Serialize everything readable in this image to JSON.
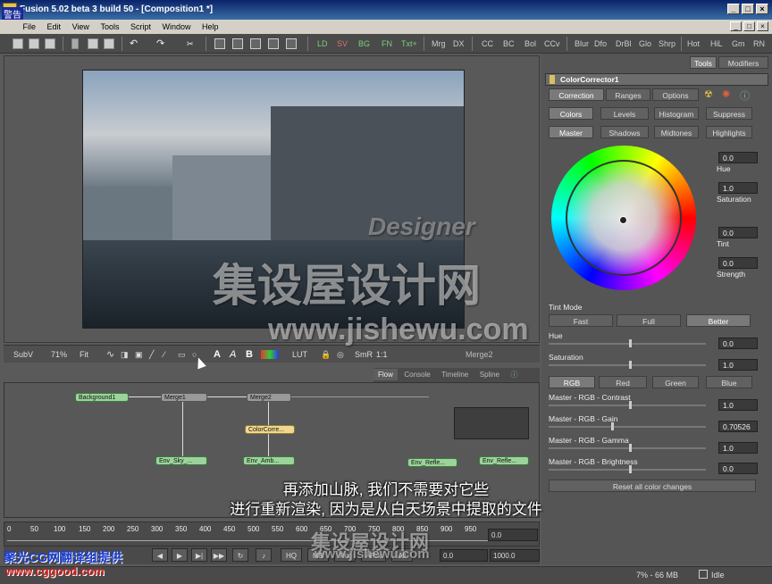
{
  "window": {
    "title": "Fusion 5.02 beta 3 build 50 - [Composition1 *]",
    "buttons": [
      "_",
      "□",
      "×"
    ]
  },
  "menu": [
    "File",
    "Edit",
    "View",
    "Tools",
    "Script",
    "Window",
    "Help"
  ],
  "toolbar": {
    "tools": [
      "LD",
      "SV",
      "BG",
      "FN",
      "Txt+",
      "Mrg",
      "DX",
      "CC",
      "BC",
      "Bol",
      "CCv",
      "Blur",
      "Dfo",
      "DrBl",
      "Glo",
      "Shrp",
      "Hot",
      "HiL",
      "Gm",
      "RN"
    ]
  },
  "viewer": {
    "subview": "SubV",
    "zoom": "71%",
    "fit": "Fit",
    "text_tools": [
      "A",
      "A",
      "B"
    ],
    "lut": "LUT",
    "smr": "SmR",
    "ratio": "1:1",
    "node": "Merge2"
  },
  "flow": {
    "tabs": [
      "Flow",
      "Console",
      "Timeline",
      "Spline"
    ],
    "nodes": {
      "bg": "Background1",
      "m1": "Merge1",
      "m2": "Merge2",
      "cc": "ColorCorre...",
      "sky": "Env_Sky_...",
      "amb": "Env_Amb...",
      "refl1": "Env_Refle...",
      "refl2": "Env_Refle..."
    }
  },
  "timeline": {
    "ticks": [
      "0",
      "50",
      "100",
      "150",
      "200",
      "250",
      "300",
      "350",
      "400",
      "450",
      "500",
      "550",
      "600",
      "650",
      "700",
      "750",
      "800",
      "850",
      "900",
      "950"
    ],
    "current": "0.0"
  },
  "transport": {
    "hq": "HQ",
    "mb": "MB",
    "prx": "Prx",
    "aprx": "APrx",
    "all": "All",
    "render_start": "0.0",
    "render_end": "1000.0"
  },
  "status": {
    "memory": "7% - 66 MB",
    "state": "Idle"
  },
  "panel": {
    "top_tabs": [
      "Tools",
      "Modifiers"
    ],
    "tool_name": "ColorCorrector1",
    "tabs": [
      "Correction",
      "Ranges",
      "Options"
    ],
    "subtabs": [
      "Colors",
      "Levels",
      "Histogram",
      "Suppress"
    ],
    "ranges": [
      "Master",
      "Shadows",
      "Midtones",
      "Highlights"
    ],
    "wheel": {
      "hue_val": "0.0",
      "hue_lbl": "Hue",
      "sat_val": "1.0",
      "sat_lbl": "Saturation",
      "tint_val": "0.0",
      "tint_lbl": "Tint",
      "str_val": "0.0",
      "str_lbl": "Strength"
    },
    "tint_mode": {
      "label": "Tint Mode",
      "options": [
        "Fast",
        "Full",
        "Better"
      ]
    },
    "hue": {
      "label": "Hue",
      "value": "0.0"
    },
    "saturation": {
      "label": "Saturation",
      "value": "1.0"
    },
    "channels": [
      "RGB",
      "Red",
      "Green",
      "Blue"
    ],
    "contrast": {
      "label": "Master - RGB - Contrast",
      "value": "1.0"
    },
    "gain": {
      "label": "Master - RGB - Gain",
      "value": "0.70526"
    },
    "gamma": {
      "label": "Master - RGB - Gamma",
      "value": "1.0"
    },
    "brightness": {
      "label": "Master - RGB - Brightness",
      "value": "0.0"
    },
    "reset": "Reset all color changes"
  },
  "subtitles": [
    "再添加山脉, 我们不需要对它些",
    "进行重新渲染, 因为是从白天场景中提取的文件"
  ],
  "watermarks": {
    "designer": "Designer",
    "jishe": "集设屋设计网",
    "url": "www.jishewu.com",
    "cg": "聚光CG网翻译组提供",
    "cgurl": "www.cggood.com",
    "corner": "警告"
  }
}
